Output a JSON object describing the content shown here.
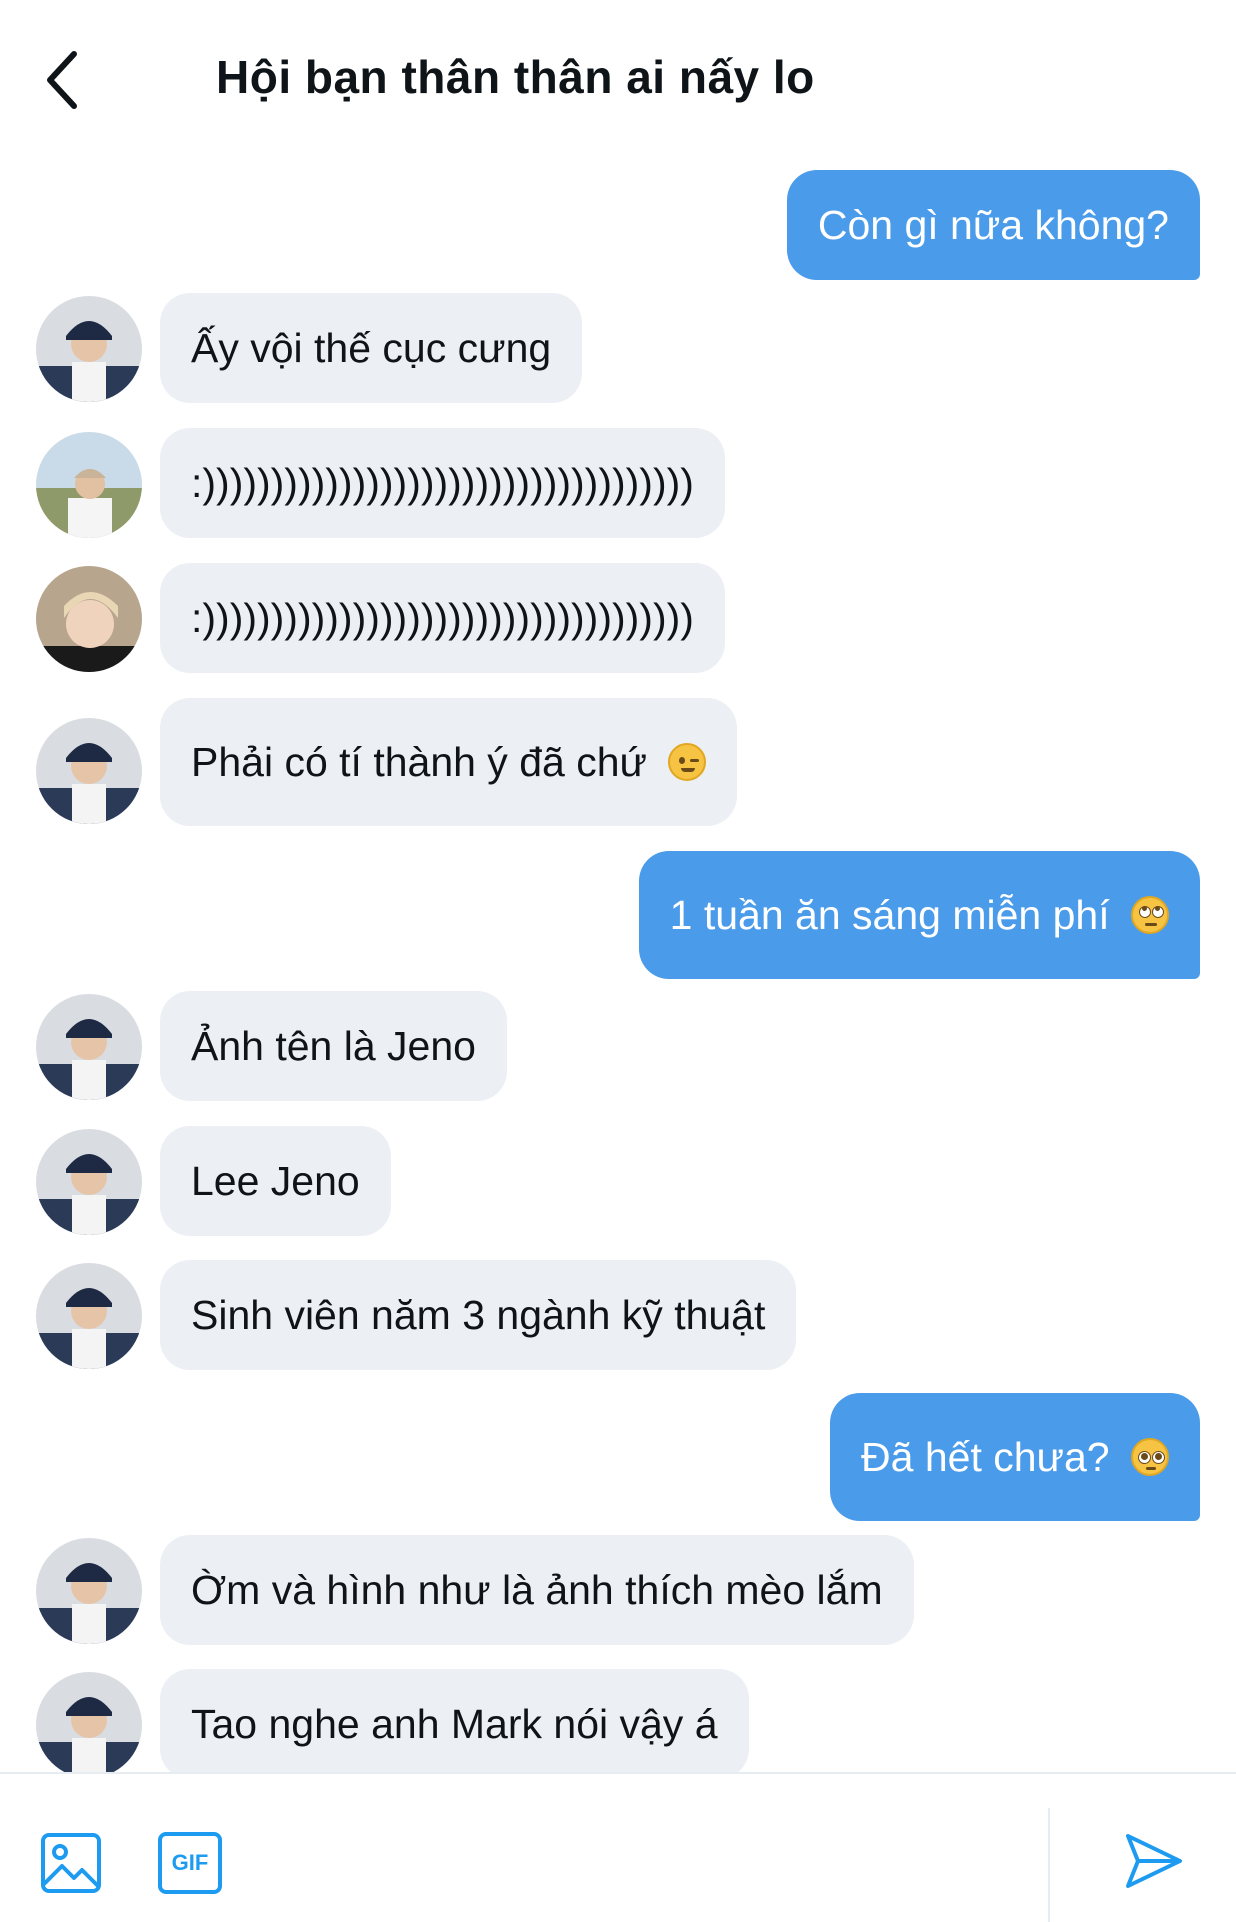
{
  "header": {
    "title": "Hội bạn thân thân ai nấy lo"
  },
  "messages": [
    {
      "id": "m1",
      "side": "out",
      "text": "Còn gì nữa không?"
    },
    {
      "id": "m2",
      "side": "in",
      "avatar": "avatar-jeno",
      "text": "Ấy vội thế cục cưng"
    },
    {
      "id": "m3",
      "side": "in",
      "avatar": "avatar-friend-outdoor",
      "text": ":))))))))))))))))))))))))))))))))))))"
    },
    {
      "id": "m4",
      "side": "in",
      "avatar": "avatar-friend-blonde",
      "text": ":))))))))))))))))))))))))))))))))))))"
    },
    {
      "id": "m5",
      "side": "in",
      "avatar": "avatar-jeno",
      "text": "Phải có tí thành ý đã chứ",
      "emoji": "winking-face"
    },
    {
      "id": "m6",
      "side": "out",
      "text": "1 tuần ăn sáng miễn phí",
      "emoji": "face-with-rolling-eyes"
    },
    {
      "id": "m7",
      "side": "in",
      "avatar": "avatar-jeno",
      "text": "Ảnh tên là Jeno"
    },
    {
      "id": "m8",
      "side": "in",
      "avatar": "avatar-jeno",
      "text": "Lee Jeno"
    },
    {
      "id": "m9",
      "side": "in",
      "avatar": "avatar-jeno",
      "text": "Sinh viên năm 3 ngành kỹ thuật"
    },
    {
      "id": "m10",
      "side": "out",
      "text": "Đã hết chưa?",
      "emoji": "pleading-face"
    },
    {
      "id": "m11",
      "side": "in",
      "avatar": "avatar-jeno",
      "text": "Ờm và hình như là ảnh thích mèo lắm"
    },
    {
      "id": "m12",
      "side": "in",
      "avatar": "avatar-jeno",
      "text": "Tao nghe anh Mark nói vậy á"
    }
  ],
  "composer": {
    "image_icon": "image-icon",
    "gif_label": "GIF",
    "send_icon": "send-icon"
  },
  "colors": {
    "outgoing_bubble": "#4a9bea",
    "incoming_bubble": "#eceff3",
    "accent": "#1d9bf0",
    "text": "#0f1419"
  }
}
